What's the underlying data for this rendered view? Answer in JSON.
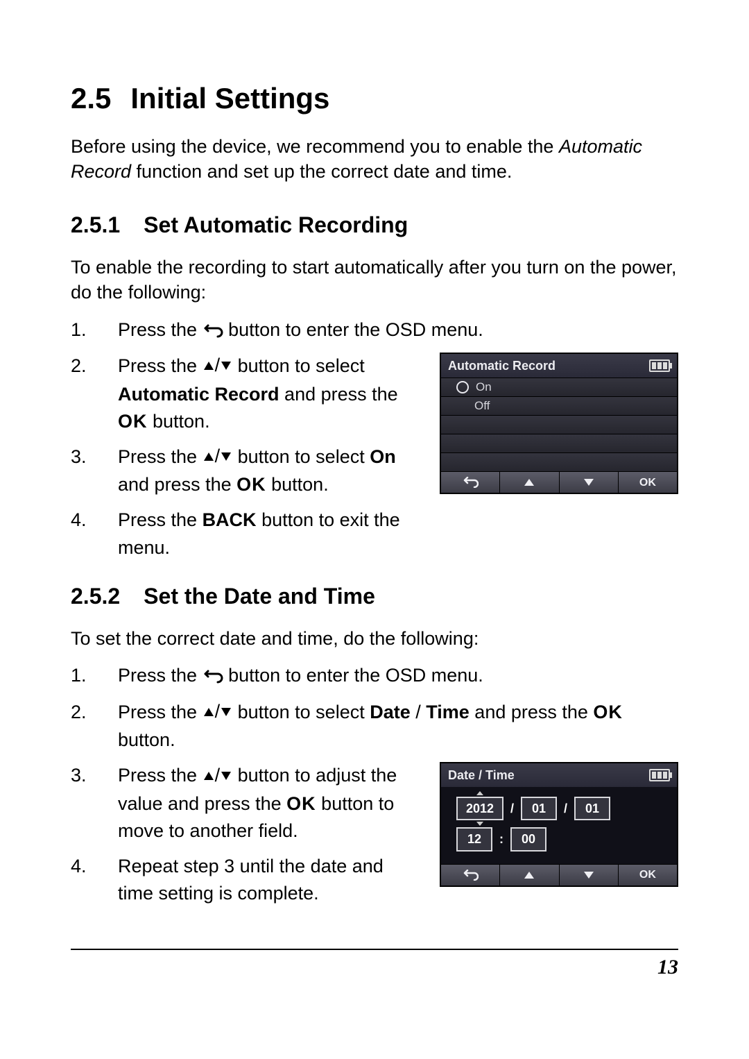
{
  "page_number": "13",
  "h1": {
    "num": "2.5",
    "title": "Initial Settings"
  },
  "intro": {
    "before": "Before using the device, we recommend you to enable the ",
    "italic": "Automatic Record",
    "after": " function and set up the correct date and time."
  },
  "sec1": {
    "num": "2.5.1",
    "title": "Set Automatic Recording",
    "lead": "To enable the recording to start automatically after you turn on the power, do the following:",
    "steps": {
      "s1": {
        "n": "1.",
        "a": "Press the ",
        "b": " button to enter the OSD menu."
      },
      "s2": {
        "n": "2.",
        "a": "Press the ",
        "b": " button to select ",
        "bold1": "Automatic Record",
        "c": " and press the ",
        "ok": "OK",
        "d": " button."
      },
      "s3": {
        "n": "3.",
        "a": "Press the ",
        "b": " button to select ",
        "bold1": "On",
        "c": " and press the ",
        "ok": "OK",
        "d": " button."
      },
      "s4": {
        "n": "4.",
        "a": "Press the ",
        "bold1": "BACK",
        "b": " button to exit the menu."
      }
    },
    "osd": {
      "title": "Automatic Record",
      "opt_on": "On",
      "opt_off": "Off",
      "ok": "OK"
    }
  },
  "sec2": {
    "num": "2.5.2",
    "title": "Set the Date and Time",
    "lead": "To set the correct date and time, do the following:",
    "steps": {
      "s1": {
        "n": "1.",
        "a": "Press the ",
        "b": " button to enter the OSD menu."
      },
      "s2": {
        "n": "2.",
        "a": "Press the ",
        "b": " button to select ",
        "bold1": "Date",
        "slash": " / ",
        "bold2": "Time",
        "c": " and press the ",
        "ok": "OK",
        "d": " button."
      },
      "s3": {
        "n": "3.",
        "a": "Press the ",
        "b": " button to adjust the value and press the ",
        "ok": "OK",
        "c": " button to move to another field."
      },
      "s4": {
        "n": "4.",
        "a": "Repeat step 3 until the date and time setting is complete."
      }
    },
    "osd": {
      "title": "Date / Time",
      "year": "2012",
      "month": "01",
      "day": "01",
      "hour": "12",
      "minute": "00",
      "slash": "/",
      "colon": ":",
      "ok": "OK"
    }
  }
}
